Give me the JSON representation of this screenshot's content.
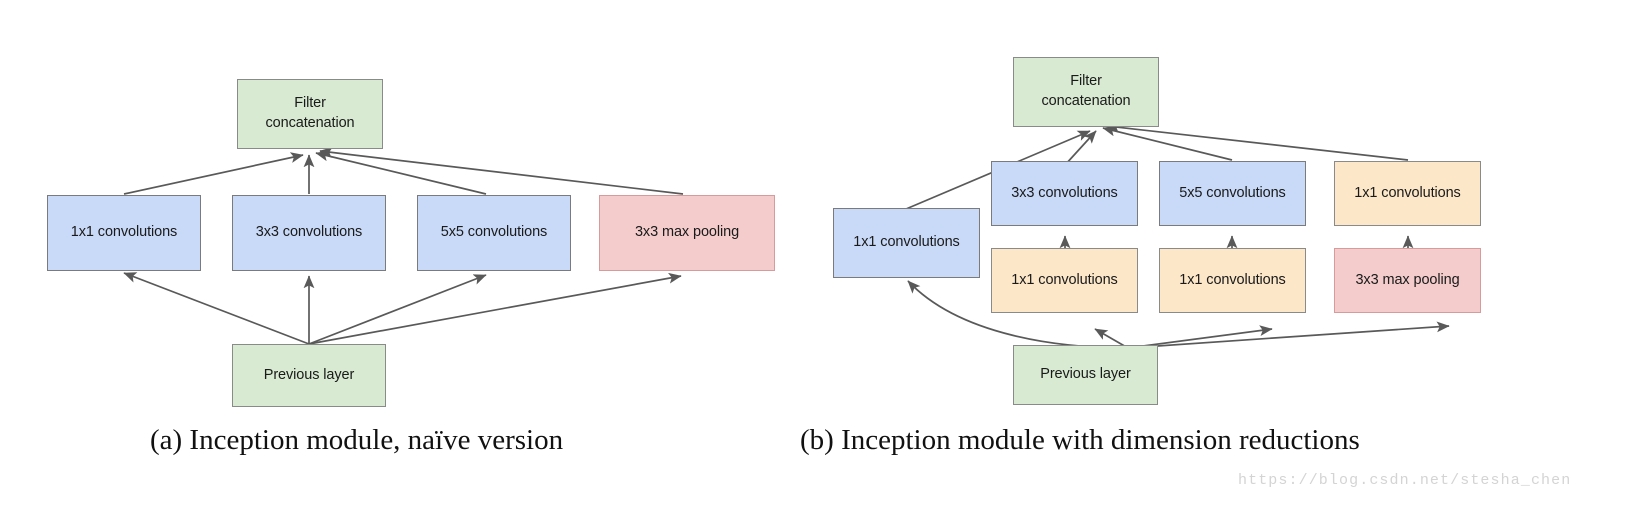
{
  "page": {
    "background": "#ffffff",
    "watermark": "https://blog.csdn.net/stesha_chen"
  },
  "palette": {
    "green": "#d9ead3",
    "blue": "#c9daf8",
    "pink": "#f4cccc",
    "yellow": "#fce7c8",
    "stroke": "#7f7f7f",
    "arrow": "#595959",
    "text": "#1a1a1a",
    "caption": "#111111",
    "watermark": "#d4d4d4"
  },
  "figure_a": {
    "caption": "(a) Inception module, naïve version",
    "nodes": {
      "filter_concatenation": "Filter\nconcatenation",
      "filter_concatenation_line1": "Filter",
      "filter_concatenation_line2": "concatenation",
      "conv1x1": "1x1 convolutions",
      "conv3x3": "3x3 convolutions",
      "conv5x5": "5x5 convolutions",
      "maxpool3x3": "3x3 max pooling",
      "previous_layer": "Previous layer"
    }
  },
  "figure_b": {
    "caption": "(b) Inception module with dimension reductions",
    "nodes": {
      "filter_concatenation_line1": "Filter",
      "filter_concatenation_line2": "concatenation",
      "conv1x1_left": "1x1 convolutions",
      "conv3x3": "3x3 convolutions",
      "conv5x5": "5x5 convolutions",
      "conv1x1_top_right": "1x1 convolutions",
      "conv1x1_reduce_a": "1x1 convolutions",
      "conv1x1_reduce_b": "1x1 convolutions",
      "maxpool3x3": "3x3 max pooling",
      "previous_layer": "Previous layer"
    }
  }
}
